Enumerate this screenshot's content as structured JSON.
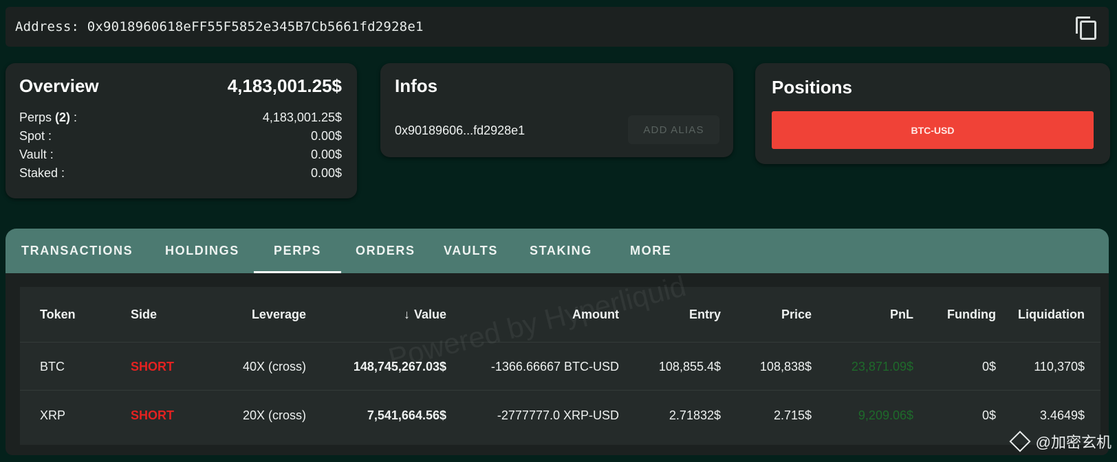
{
  "address": {
    "label": "Address:",
    "value": "0x9018960618eFF55F5852e345B7Cb5661fd2928e1"
  },
  "overview": {
    "title": "Overview",
    "total": "4,183,001.25$",
    "rows": [
      {
        "label": "Perps",
        "count": "(2)",
        "suffix": " :",
        "value": "4,183,001.25$"
      },
      {
        "label": "Spot :",
        "value": "0.00$"
      },
      {
        "label": "Vault :",
        "value": "0.00$"
      },
      {
        "label": "Staked :",
        "value": "0.00$"
      }
    ]
  },
  "infos": {
    "title": "Infos",
    "short_address": "0x90189606...fd2928e1",
    "alias_button": "ADD ALIAS"
  },
  "positions": {
    "title": "Positions",
    "bar_label": "BTC-USD",
    "bar_color": "#f04237"
  },
  "tabs": [
    "TRANSACTIONS",
    "HOLDINGS",
    "PERPS",
    "ORDERS",
    "VAULTS",
    "STAKING",
    "MORE"
  ],
  "active_tab": "PERPS",
  "table": {
    "headers": [
      "Token",
      "Side",
      "Leverage",
      "Value",
      "Amount",
      "Entry",
      "Price",
      "PnL",
      "Funding",
      "Liquidation"
    ],
    "sort_indicator": "↓",
    "rows": [
      [
        "BTC",
        "SHORT",
        "40X (cross)",
        "148,745,267.03$",
        "-1366.66667 BTC-USD",
        "108,855.4$",
        "108,838$",
        "23,871.09$",
        "0$",
        "110,370$"
      ],
      [
        "XRP",
        "SHORT",
        "20X (cross)",
        "7,541,664.56$",
        "-2777777.0 XRP-USD",
        "2.71832$",
        "2.715$",
        "9,209.06$",
        "0$",
        "3.4649$"
      ]
    ]
  },
  "watermark": "Powered by Hyperliquid",
  "brand": "@加密玄机",
  "colors": {
    "short": "#e32221",
    "pnl_positive": "#1e6a2a",
    "tab_bar": "#4c7a71",
    "background": "#04211b"
  }
}
